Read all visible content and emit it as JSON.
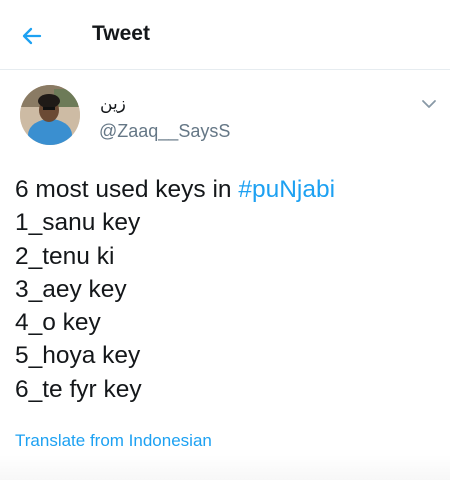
{
  "header": {
    "title": "Tweet",
    "back_icon": "arrow-left-icon"
  },
  "author": {
    "display_name": "زین",
    "handle": "@Zaaq__SaysS",
    "avatar_icon": "avatar"
  },
  "tweet": {
    "first_line_text": "6 most used keys in ",
    "hashtag": "#puNjabi",
    "lines": [
      "1_sanu key",
      "2_tenu ki",
      "3_aey key",
      "4_o key",
      "5_hoya key",
      "6_te fyr key"
    ]
  },
  "translate_link": "Translate from Indonesian",
  "colors": {
    "accent": "#1da1f2",
    "text": "#14171a",
    "secondary": "#657786",
    "divider": "#e6ecf0"
  }
}
